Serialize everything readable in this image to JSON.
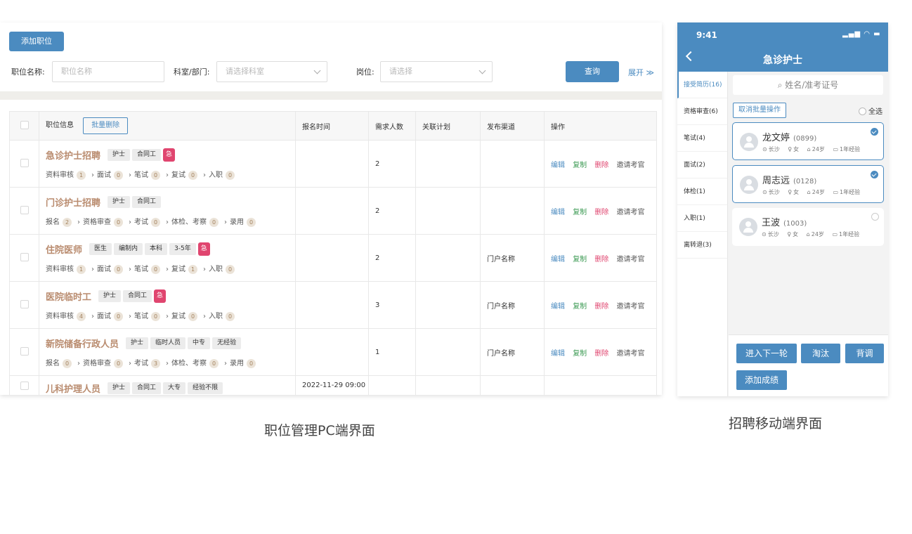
{
  "pc": {
    "add_button": "添加职位",
    "filters": {
      "position_label": "职位名称:",
      "position_placeholder": "职位名称",
      "dept_label": "科室/部门:",
      "dept_placeholder": "请选择科室",
      "post_label": "岗位:",
      "post_placeholder": "请选择"
    },
    "query_button": "查询",
    "expand_label": "展开 ≫",
    "table": {
      "headers": [
        "职位信息",
        "报名时间",
        "需求人数",
        "关联计划",
        "发布渠道",
        "操作"
      ],
      "batch_delete": "批量删除",
      "rows": [
        {
          "title": "急诊护士招聘",
          "tags": [
            "护士",
            "合同工"
          ],
          "urgent": "急",
          "stages": [
            {
              "n": "资料审核",
              "c": "1"
            },
            {
              "n": "面试",
              "c": "0"
            },
            {
              "n": "笔试",
              "c": "0"
            },
            {
              "n": "复试",
              "c": "0"
            },
            {
              "n": "入职",
              "c": "0"
            }
          ],
          "time": "",
          "need": "2",
          "plan": "",
          "channel": ""
        },
        {
          "title": "门诊护士招聘",
          "tags": [
            "护士",
            "合同工"
          ],
          "urgent": "",
          "stages": [
            {
              "n": "报名",
              "c": "2"
            },
            {
              "n": "资格审查",
              "c": "0"
            },
            {
              "n": "考试",
              "c": "0"
            },
            {
              "n": "体检、考察",
              "c": "0"
            },
            {
              "n": "录用",
              "c": "0"
            }
          ],
          "time": "",
          "need": "2",
          "plan": "",
          "channel": ""
        },
        {
          "title": "住院医师",
          "tags": [
            "医生",
            "编制内",
            "本科",
            "3-5年"
          ],
          "urgent": "急",
          "stages": [
            {
              "n": "资料审核",
              "c": "1"
            },
            {
              "n": "面试",
              "c": "0"
            },
            {
              "n": "笔试",
              "c": "0"
            },
            {
              "n": "复试",
              "c": "1"
            },
            {
              "n": "入职",
              "c": "0"
            }
          ],
          "time": "",
          "need": "2",
          "plan": "",
          "channel": "门户名称"
        },
        {
          "title": "医院临时工",
          "tags": [
            "护士",
            "合同工"
          ],
          "urgent": "急",
          "stages": [
            {
              "n": "资料审核",
              "c": "4"
            },
            {
              "n": "面试",
              "c": "0"
            },
            {
              "n": "笔试",
              "c": "0"
            },
            {
              "n": "复试",
              "c": "0"
            },
            {
              "n": "入职",
              "c": "0"
            }
          ],
          "time": "",
          "need": "3",
          "plan": "",
          "channel": "门户名称"
        },
        {
          "title": "新院储备行政人员",
          "tags": [
            "护士",
            "临时人员",
            "中专",
            "无经验"
          ],
          "urgent": "",
          "stages": [
            {
              "n": "报名",
              "c": "0"
            },
            {
              "n": "资格审查",
              "c": "0"
            },
            {
              "n": "考试",
              "c": "3"
            },
            {
              "n": "体检、考察",
              "c": "0"
            },
            {
              "n": "录用",
              "c": "0"
            }
          ],
          "time": "",
          "need": "1",
          "plan": "",
          "channel": "门户名称"
        },
        {
          "title": "儿科护理人员",
          "tags": [
            "护士",
            "合同工",
            "大专",
            "经验不限"
          ],
          "urgent": "",
          "stages": [],
          "time": "2022-11-29 09:00",
          "need": "",
          "plan": "",
          "channel": ""
        }
      ],
      "ops": {
        "edit": "编辑",
        "copy": "复制",
        "delete": "删除",
        "invite": "邀请考官"
      }
    },
    "caption": "职位管理PC端界面"
  },
  "mobile": {
    "time": "9:41",
    "signal": "▂▄▆ ◠ ▬",
    "title": "急诊护士",
    "side_items": [
      "接受简历(16)",
      "资格审查(6)",
      "笔试(4)",
      "面试(2)",
      "体检(1)",
      "入职(1)",
      "离转退(3)"
    ],
    "search_placeholder": "姓名/准考证号",
    "cancel_batch": "取消批量操作",
    "select_all": "全选",
    "candidates": [
      {
        "name": "龙文婷",
        "id": "(0899)",
        "city": "长沙",
        "gender": "女",
        "age": "24岁",
        "exp": "1年经验",
        "checked": true
      },
      {
        "name": "周志远",
        "id": "(0128)",
        "city": "长沙",
        "gender": "女",
        "age": "24岁",
        "exp": "1年经验",
        "checked": true
      },
      {
        "name": "王波",
        "id": "(1003)",
        "city": "长沙",
        "gender": "女",
        "age": "24岁",
        "exp": "1年经验",
        "checked": false
      }
    ],
    "buttons": {
      "next": "进入下一轮",
      "eliminate": "淘汰",
      "background": "背调",
      "add_score": "添加成绩"
    },
    "caption": "招聘移动端界面"
  },
  "colors": {
    "primary": "#4b8bc0",
    "urgent": "#e0456f",
    "job_title": "#b98b6e"
  }
}
